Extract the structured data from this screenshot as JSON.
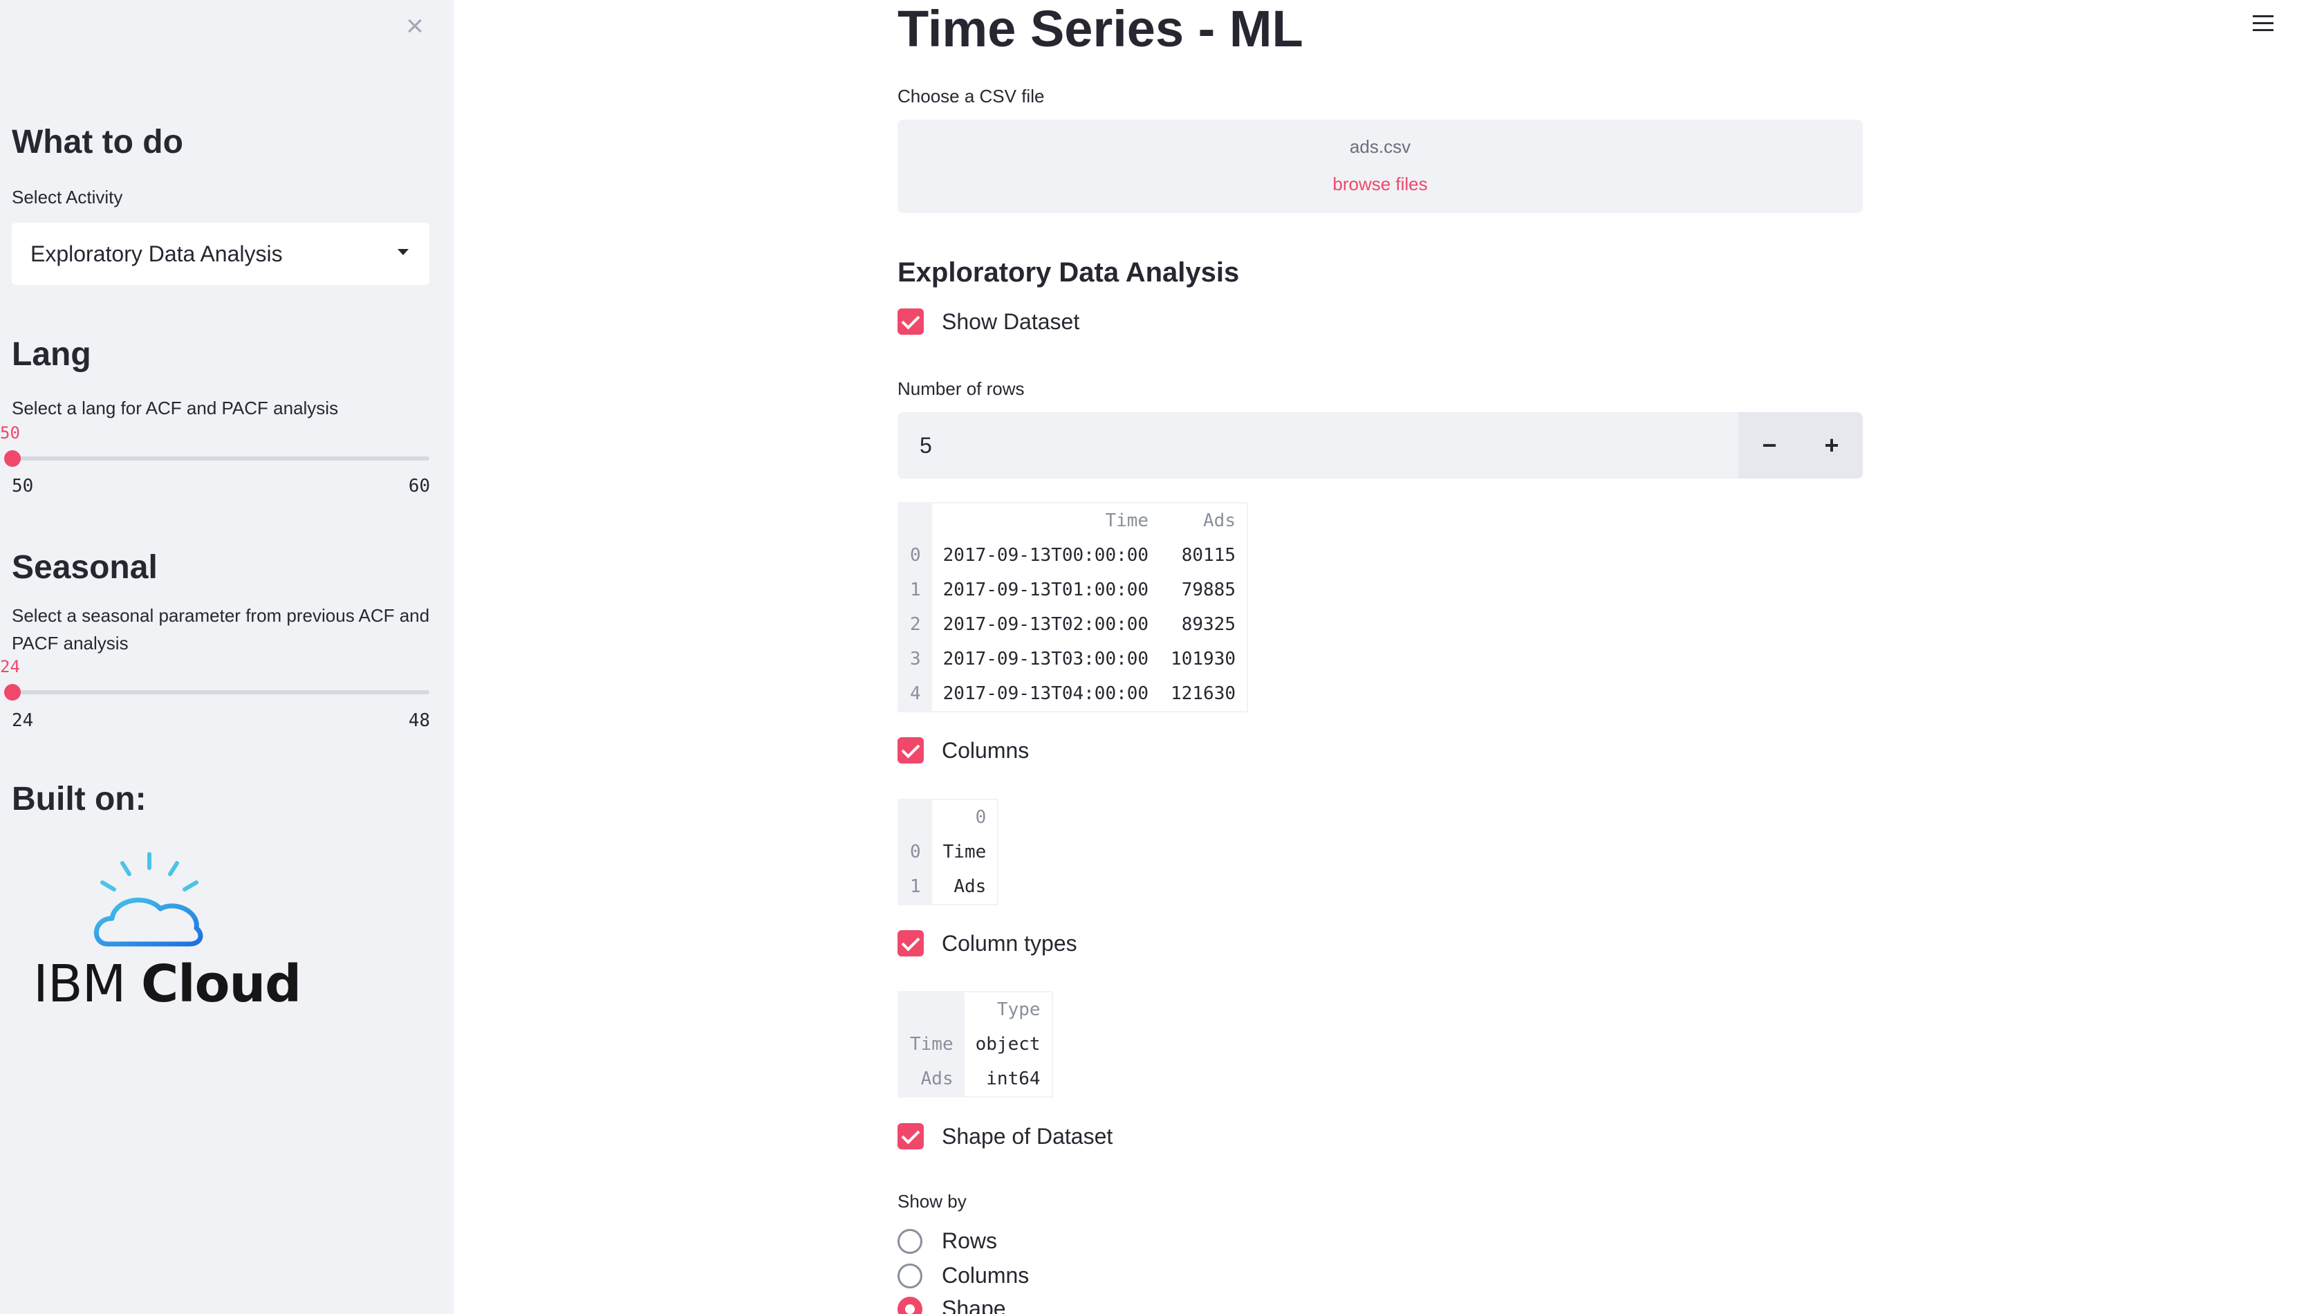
{
  "sidebar": {
    "close_icon": "close-icon",
    "what_to_do": {
      "heading": "What to do",
      "label": "Select Activity",
      "selected": "Exploratory Data Analysis"
    },
    "lang": {
      "heading": "Lang",
      "label": "Select a lang for ACF and PACF analysis",
      "value": "50",
      "min": "50",
      "max": "60"
    },
    "seasonal": {
      "heading": "Seasonal",
      "label": "Select a seasonal parameter from previous ACF and PACF analysis",
      "value": "24",
      "min": "24",
      "max": "48"
    },
    "built_on": {
      "heading": "Built on:",
      "logo_text_light": "IBM",
      "logo_text_bold": "Cloud"
    }
  },
  "main": {
    "title": "Time Series - ML",
    "uploader": {
      "label": "Choose a CSV file",
      "filename": "ads.csv",
      "browse": "browse files"
    },
    "section_title": "Exploratory Data Analysis",
    "show_dataset": "Show Dataset",
    "rows_label": "Number of rows",
    "rows_value": "5",
    "minus": "−",
    "plus": "+",
    "dataset_table": {
      "headers": [
        "",
        "Time",
        "Ads"
      ],
      "rows": [
        [
          "0",
          "2017-09-13T00:00:00",
          "80115"
        ],
        [
          "1",
          "2017-09-13T01:00:00",
          "79885"
        ],
        [
          "2",
          "2017-09-13T02:00:00",
          "89325"
        ],
        [
          "3",
          "2017-09-13T03:00:00",
          "101930"
        ],
        [
          "4",
          "2017-09-13T04:00:00",
          "121630"
        ]
      ]
    },
    "columns_check": "Columns",
    "columns_table": {
      "headers": [
        "",
        "0"
      ],
      "rows": [
        [
          "0",
          "Time"
        ],
        [
          "1",
          "Ads"
        ]
      ]
    },
    "column_types_check": "Column types",
    "types_table": {
      "headers": [
        "",
        "Type"
      ],
      "rows": [
        [
          "Time",
          "object"
        ],
        [
          "Ads",
          "int64"
        ]
      ]
    },
    "shape_check": "Shape of Dataset",
    "show_by": {
      "label": "Show by",
      "options": [
        "Rows",
        "Columns",
        "Shape"
      ],
      "selected": "Shape"
    }
  },
  "colors": {
    "accent": "#f0486a",
    "sidebar_bg": "#f0f2f6",
    "text": "#262730"
  }
}
